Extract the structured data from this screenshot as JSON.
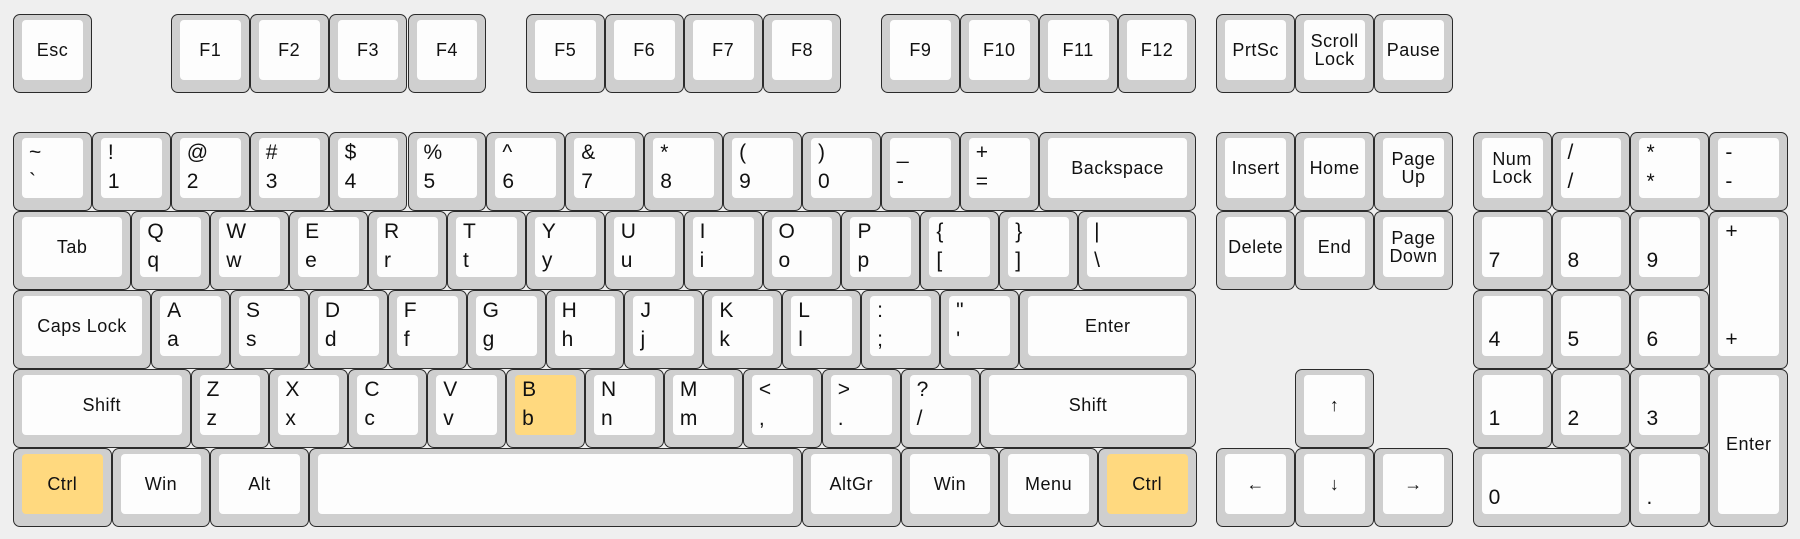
{
  "highlight_color": "#ffd97f",
  "keys": [
    {
      "label": "Esc"
    },
    {
      "label": "F1"
    },
    {
      "label": "F2"
    },
    {
      "label": "F3"
    },
    {
      "label": "F4"
    },
    {
      "label": "F5"
    },
    {
      "label": "F6"
    },
    {
      "label": "F7"
    },
    {
      "label": "F8"
    },
    {
      "label": "F9"
    },
    {
      "label": "F10"
    },
    {
      "label": "F11"
    },
    {
      "label": "F12"
    },
    {
      "label": "PrtSc"
    },
    {
      "label": "Scroll\nLock"
    },
    {
      "label": "Pause"
    },
    {
      "top": "~",
      "bottom": "`"
    },
    {
      "top": "!",
      "bottom": "1"
    },
    {
      "top": "@",
      "bottom": "2"
    },
    {
      "top": "#",
      "bottom": "3"
    },
    {
      "top": "$",
      "bottom": "4"
    },
    {
      "top": "%",
      "bottom": "5"
    },
    {
      "top": "^",
      "bottom": "6"
    },
    {
      "top": "&",
      "bottom": "7"
    },
    {
      "top": "*",
      "bottom": "8"
    },
    {
      "top": "(",
      "bottom": "9"
    },
    {
      "top": ")",
      "bottom": "0"
    },
    {
      "top": "_",
      "bottom": "-"
    },
    {
      "top": "+",
      "bottom": "="
    },
    {
      "label": "Backspace"
    },
    {
      "label": "Insert"
    },
    {
      "label": "Home"
    },
    {
      "label": "Page\nUp"
    },
    {
      "label": "Num\nLock"
    },
    {
      "top": "/",
      "bottom": "/"
    },
    {
      "top": "*",
      "bottom": "*"
    },
    {
      "top": "-",
      "bottom": "-"
    },
    {
      "label": "Tab"
    },
    {
      "top": "Q",
      "bottom": "q"
    },
    {
      "top": "W",
      "bottom": "w"
    },
    {
      "top": "E",
      "bottom": "e"
    },
    {
      "top": "R",
      "bottom": "r"
    },
    {
      "top": "T",
      "bottom": "t"
    },
    {
      "top": "Y",
      "bottom": "y"
    },
    {
      "top": "U",
      "bottom": "u"
    },
    {
      "top": "I",
      "bottom": "i"
    },
    {
      "top": "O",
      "bottom": "o"
    },
    {
      "top": "P",
      "bottom": "p"
    },
    {
      "top": "{",
      "bottom": "["
    },
    {
      "top": "}",
      "bottom": "]"
    },
    {
      "top": "|",
      "bottom": "\\"
    },
    {
      "label": "Delete"
    },
    {
      "label": "End"
    },
    {
      "label": "Page\nDown"
    },
    {
      "top": "",
      "bottom": "7"
    },
    {
      "top": "",
      "bottom": "8"
    },
    {
      "top": "",
      "bottom": "9"
    },
    {
      "top": "+",
      "bottom": "+"
    },
    {
      "label": "Caps Lock"
    },
    {
      "top": "A",
      "bottom": "a"
    },
    {
      "top": "S",
      "bottom": "s"
    },
    {
      "top": "D",
      "bottom": "d"
    },
    {
      "top": "F",
      "bottom": "f"
    },
    {
      "top": "G",
      "bottom": "g"
    },
    {
      "top": "H",
      "bottom": "h"
    },
    {
      "top": "J",
      "bottom": "j"
    },
    {
      "top": "K",
      "bottom": "k"
    },
    {
      "top": "L",
      "bottom": "l"
    },
    {
      "top": ":",
      "bottom": ";"
    },
    {
      "top": "\"",
      "bottom": "'"
    },
    {
      "label": "Enter"
    },
    {
      "top": "",
      "bottom": "4"
    },
    {
      "top": "",
      "bottom": "5"
    },
    {
      "top": "",
      "bottom": "6"
    },
    {
      "label": "Shift"
    },
    {
      "top": "Z",
      "bottom": "z"
    },
    {
      "top": "X",
      "bottom": "x"
    },
    {
      "top": "C",
      "bottom": "c"
    },
    {
      "top": "V",
      "bottom": "v"
    },
    {
      "top": "B",
      "bottom": "b",
      "highlighted": true
    },
    {
      "top": "N",
      "bottom": "n"
    },
    {
      "top": "M",
      "bottom": "m"
    },
    {
      "top": "<",
      "bottom": ","
    },
    {
      "top": ">",
      "bottom": "."
    },
    {
      "top": "?",
      "bottom": "/"
    },
    {
      "label": "Shift"
    },
    {
      "label": "↑"
    },
    {
      "top": "",
      "bottom": "1"
    },
    {
      "top": "",
      "bottom": "2"
    },
    {
      "top": "",
      "bottom": "3"
    },
    {
      "label": "Enter"
    },
    {
      "label": "Ctrl",
      "highlighted": true
    },
    {
      "label": "Win"
    },
    {
      "label": "Alt"
    },
    {
      "label": ""
    },
    {
      "label": "AltGr"
    },
    {
      "label": "Win"
    },
    {
      "label": "Menu"
    },
    {
      "label": "Ctrl",
      "highlighted": true
    },
    {
      "label": "←"
    },
    {
      "label": "↓"
    },
    {
      "label": "→"
    },
    {
      "top": "",
      "bottom": "0"
    },
    {
      "top": "",
      "bottom": "."
    }
  ]
}
